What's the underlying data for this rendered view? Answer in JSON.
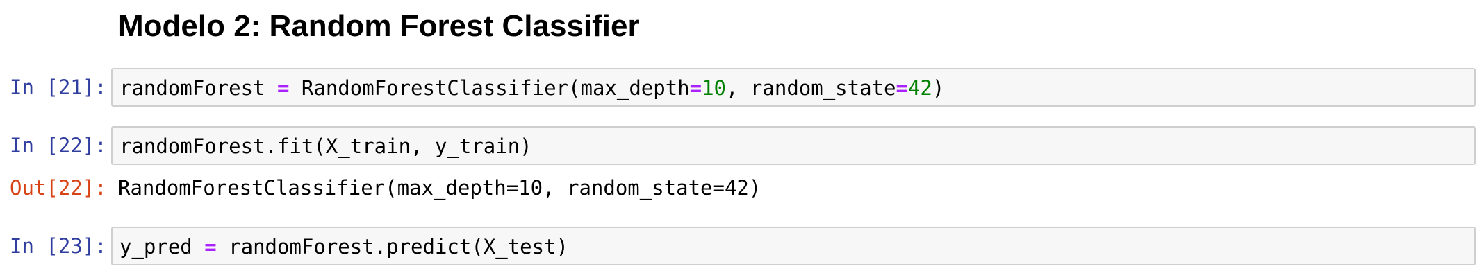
{
  "heading": "Modelo 2: Random Forest Classifier",
  "cells": [
    {
      "prompt": "In [21]:",
      "code": {
        "t1": "randomForest ",
        "op1": "=",
        "t2": " RandomForestClassifier(max_depth",
        "op2": "=",
        "num1": "10",
        "t3": ", random_state",
        "op3": "=",
        "num2": "42",
        "t4": ")"
      }
    },
    {
      "prompt": "In [22]:",
      "code": {
        "t1": "randomForest.fit(X_train, y_train)"
      },
      "out_prompt": "Out[22]:",
      "output": "RandomForestClassifier(max_depth=10, random_state=42)"
    },
    {
      "prompt": "In [23]:",
      "code": {
        "t1": "y_pred ",
        "op1": "=",
        "t2": " randomForest.predict(X_test)"
      }
    }
  ],
  "colors": {
    "in_prompt": "#303f9f",
    "out_prompt": "#d84315",
    "operator": "#aa22ff",
    "number": "#008000",
    "cell_background": "#f7f7f7",
    "cell_border": "#cfcfcf"
  }
}
